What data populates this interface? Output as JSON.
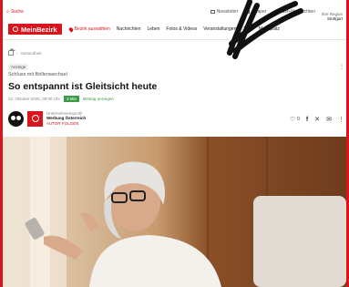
{
  "topbar": {
    "search_label": "Suche",
    "links": [
      "Newsletter",
      "ePaper",
      "Push-Nachrichten"
    ],
    "region_label": "Ihre Region",
    "region_value": "Stuttgart"
  },
  "navbar": {
    "logo": "MeinBezirk",
    "region_button": "Bezirk auswählen",
    "items": [
      "Nachrichten",
      "Leben",
      "Fotos & Videos",
      "Veranstaltungen",
      "Jobs",
      "Marktplatz"
    ]
  },
  "breadcrumb": {
    "items": [
      "Gesundheit"
    ]
  },
  "article": {
    "badge": "Anzeige",
    "kicker": "Schluss mit Brillenwechsel",
    "headline": "So entspannt ist Gleitsicht heute",
    "date": "22. Oktober 2025, 09:00 Uhr",
    "read_time": "3 Min",
    "vote": "Beitrag anzeigen",
    "author_label": "Unternehmensprofil",
    "author_name": "Werbung Österreich",
    "follow": "Autor folgen",
    "like_count": "0"
  },
  "colors": {
    "brand": "#d9141c",
    "readtime": "#3a9a45"
  },
  "icons": [
    "search-icon",
    "newsletter-icon",
    "epaper-icon",
    "bell-icon",
    "pin-icon",
    "home-icon",
    "heart-icon",
    "facebook-icon",
    "x-icon",
    "mail-icon",
    "more-icon"
  ]
}
